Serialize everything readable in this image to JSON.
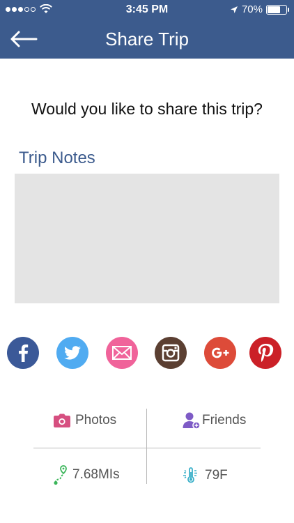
{
  "status_bar": {
    "time": "3:45 PM",
    "battery_text": "70%",
    "battery_level": 0.7
  },
  "nav": {
    "title": "Share Trip",
    "back_icon": "arrow-left-icon"
  },
  "prompt": {
    "question": "Would you like to share this trip?"
  },
  "notes": {
    "label": "Trip Notes",
    "value": "",
    "placeholder": ""
  },
  "share_buttons": [
    {
      "icon": "facebook-icon",
      "color": "#3b5998"
    },
    {
      "icon": "twitter-icon",
      "color": "#50abf1"
    },
    {
      "icon": "email-icon",
      "color": "#f0639a"
    },
    {
      "icon": "instagram-icon",
      "color": "#5b3f32"
    },
    {
      "icon": "google-plus-icon",
      "color": "#dd4b39"
    },
    {
      "icon": "pinterest-icon",
      "color": "#cb2027"
    }
  ],
  "stats": {
    "photos": {
      "label": "Photos",
      "icon": "camera-icon",
      "color": "#d64f80"
    },
    "friends": {
      "label": "Friends",
      "icon": "add-friend-icon",
      "color": "#7e5bc6"
    },
    "distance": {
      "value": "7.68MIs",
      "icon": "route-icon",
      "color": "#3bb55a"
    },
    "temperature": {
      "value": "79F",
      "icon": "thermometer-icon",
      "color": "#3bb0c9"
    }
  },
  "colors": {
    "header": "#3c5b8d",
    "accent": "#3c5b8d",
    "notes_bg": "#e4e4e4"
  }
}
